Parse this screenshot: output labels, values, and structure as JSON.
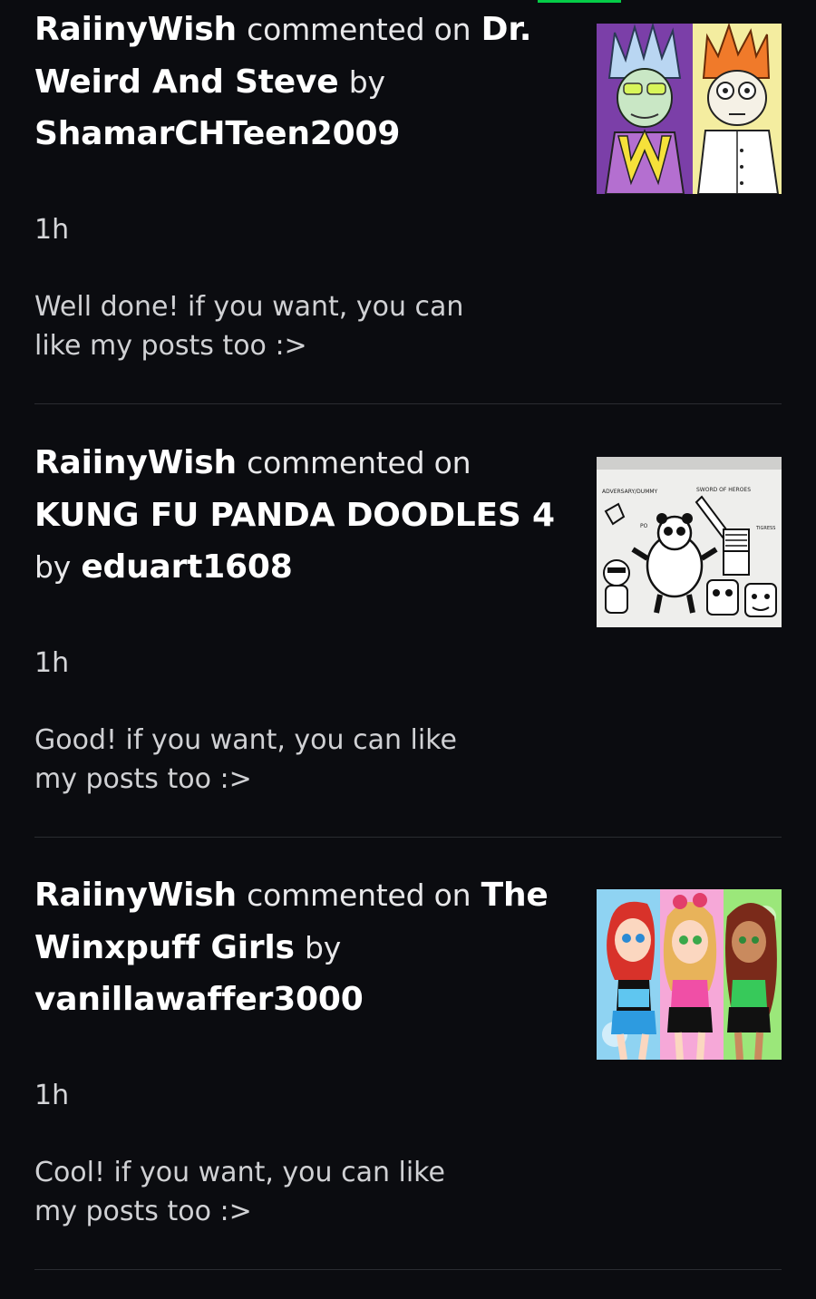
{
  "notifications": [
    {
      "user": "RaiinyWish",
      "action": "commented on",
      "deviation": "Dr. Weird And Steve",
      "by": "by",
      "artist": "ShamarCHTeen2009",
      "time": "1h",
      "comment": "Well done! if you want, you can like my posts too :>",
      "thumbnail": "dr-weird-and-steve-artwork"
    },
    {
      "user": "RaiinyWish",
      "action": "commented on",
      "deviation": "KUNG FU PANDA DOODLES 4",
      "by": "by",
      "artist": "eduart1608",
      "time": "1h",
      "comment": "Good! if you want, you can like my posts too :>",
      "thumbnail": "kung-fu-panda-doodles-artwork",
      "thumbnail_labels": {
        "left": "ADVERSARY/DUMMY",
        "right": "SWORD OF HEROES",
        "po": "PO",
        "tigress": "TIGRESS"
      }
    },
    {
      "user": "RaiinyWish",
      "action": "commented on",
      "deviation": "The Winxpuff Girls",
      "by": "by",
      "artist": "vanillawaffer3000",
      "time": "1h",
      "comment": "Cool! if you want, you can like my posts too :>",
      "thumbnail": "winxpuff-girls-artwork"
    }
  ],
  "colors": {
    "background": "#0b0c10",
    "accent": "#05cc47",
    "divider": "#2a2c31"
  }
}
